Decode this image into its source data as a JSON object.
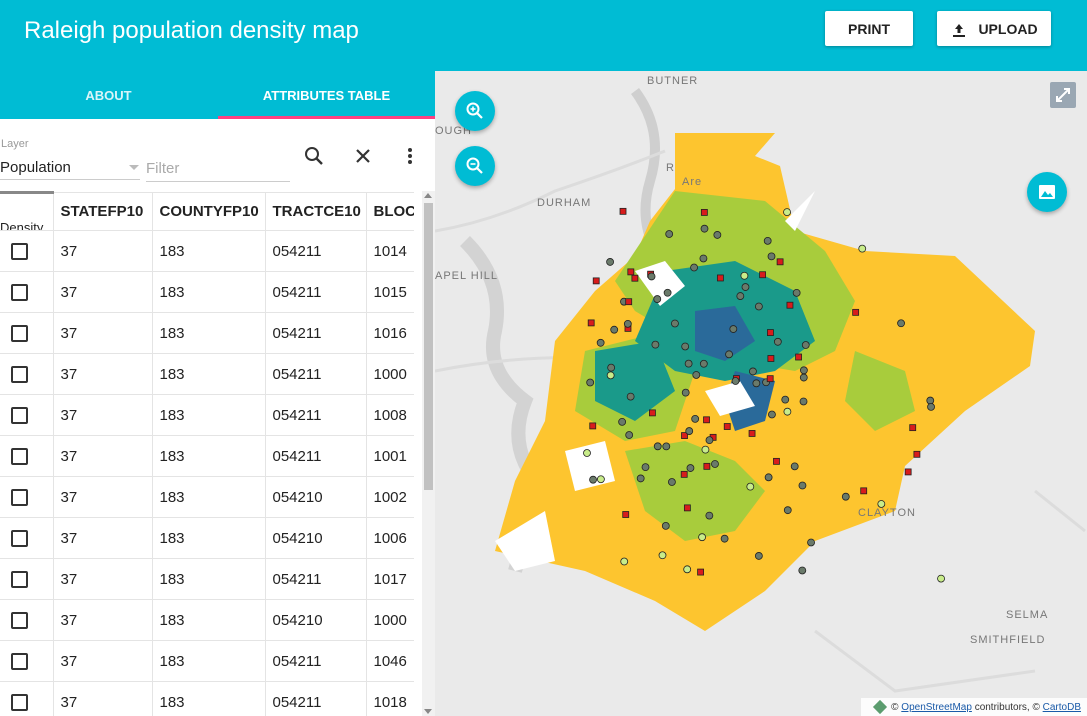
{
  "header": {
    "title": "Raleigh population density map",
    "print_label": "PRINT",
    "upload_label": "UPLOAD"
  },
  "tabs": [
    {
      "label": "ABOUT",
      "active": false
    },
    {
      "label": "ATTRIBUTES TABLE",
      "active": true
    }
  ],
  "layer": {
    "label": "Layer",
    "value": "Population",
    "filter_placeholder": "Filter"
  },
  "table": {
    "first_column_label": "Density",
    "columns": [
      "STATEFP10",
      "COUNTYFP10",
      "TRACTCE10",
      "BLOC"
    ],
    "rows": [
      [
        "37",
        "183",
        "054211",
        "1014"
      ],
      [
        "37",
        "183",
        "054211",
        "1015"
      ],
      [
        "37",
        "183",
        "054211",
        "1016"
      ],
      [
        "37",
        "183",
        "054211",
        "1000"
      ],
      [
        "37",
        "183",
        "054211",
        "1008"
      ],
      [
        "37",
        "183",
        "054211",
        "1001"
      ],
      [
        "37",
        "183",
        "054210",
        "1002"
      ],
      [
        "37",
        "183",
        "054210",
        "1006"
      ],
      [
        "37",
        "183",
        "054211",
        "1017"
      ],
      [
        "37",
        "183",
        "054210",
        "1000"
      ],
      [
        "37",
        "183",
        "054211",
        "1046"
      ],
      [
        "37",
        "183",
        "054211",
        "1018"
      ]
    ]
  },
  "map": {
    "places": [
      "BUTNER",
      "DURHAM",
      "APEL HILL",
      "OUGH",
      "CLAYTON",
      "SELMA",
      "SMITHFIELD",
      "R",
      "Are"
    ],
    "attribution": {
      "prefix": "©",
      "osm": "OpenStreetMap",
      "middle": "contributors, ©",
      "carto": "CartoDB"
    },
    "colors": {
      "header": "#00bcd4",
      "density_low": "#fdc52f",
      "density_mid": "#a8cc3c",
      "density_high": "#1a9a8a",
      "density_top": "#2a6a9a",
      "marker_red": "#d81c1c",
      "marker_gray": "#6a7a6a",
      "marker_light": "#c8ec8a"
    }
  }
}
